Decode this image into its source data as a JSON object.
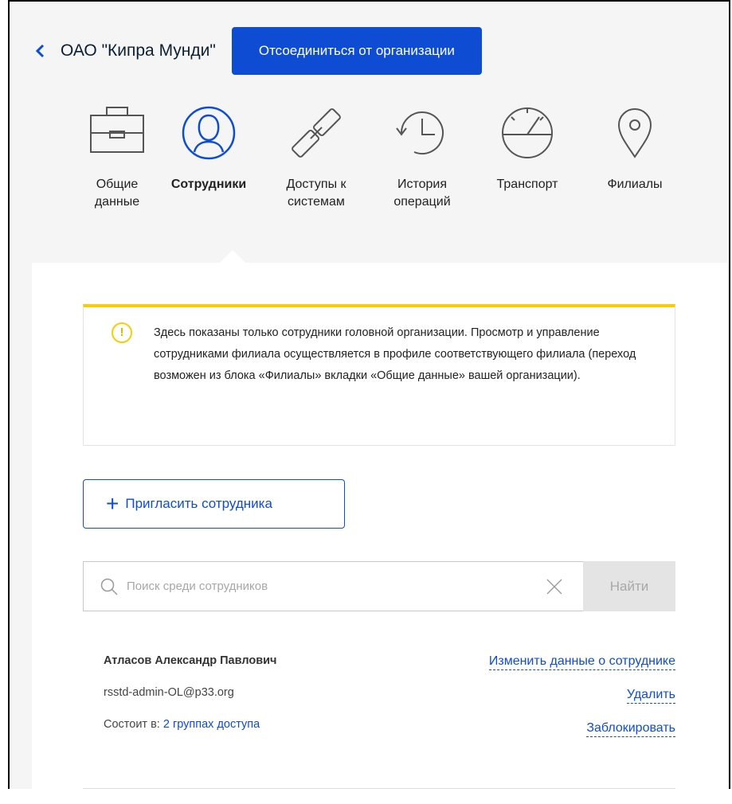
{
  "header": {
    "org_title": "ОАО \"Кипра Мунди\"",
    "disconnect_label": "Отсоединиться от организации"
  },
  "tabs": [
    {
      "label": "Общие\nданные",
      "icon": "briefcase-icon",
      "active": false
    },
    {
      "label": "Сотрудники",
      "icon": "user-icon",
      "active": true
    },
    {
      "label": "Доступы к\nсистемам",
      "icon": "link-icon",
      "active": false
    },
    {
      "label": "История\nопераций",
      "icon": "history-icon",
      "active": false
    },
    {
      "label": "Транспорт",
      "icon": "speedometer-icon",
      "active": false
    },
    {
      "label": "Филиалы",
      "icon": "map-pin-icon",
      "active": false
    }
  ],
  "notice": {
    "text": "Здесь показаны только сотрудники головной организации. Просмотр и управление сотрудниками филиала осуществляется в профиле соответствующего филиала (переход возможен из блока «Филиалы» вкладки «Общие данные» вашей организации)."
  },
  "invite_label": "Пригласить сотрудника",
  "search": {
    "placeholder": "Поиск среди сотрудников",
    "value": "",
    "button_label": "Найти"
  },
  "employee": {
    "name": "Атласов Александр Павлович",
    "email": "rsstd-admin-OL@p33.org",
    "groups_prefix": "Состоит в:",
    "groups_link": "2 группах доступа",
    "edit_label": "Изменить данные о сотруднике",
    "delete_label": "Удалить",
    "block_label": "Заблокировать"
  },
  "colors": {
    "primary": "#0d4cd3",
    "warning": "#fccb08",
    "background": "#f5f5f5"
  }
}
